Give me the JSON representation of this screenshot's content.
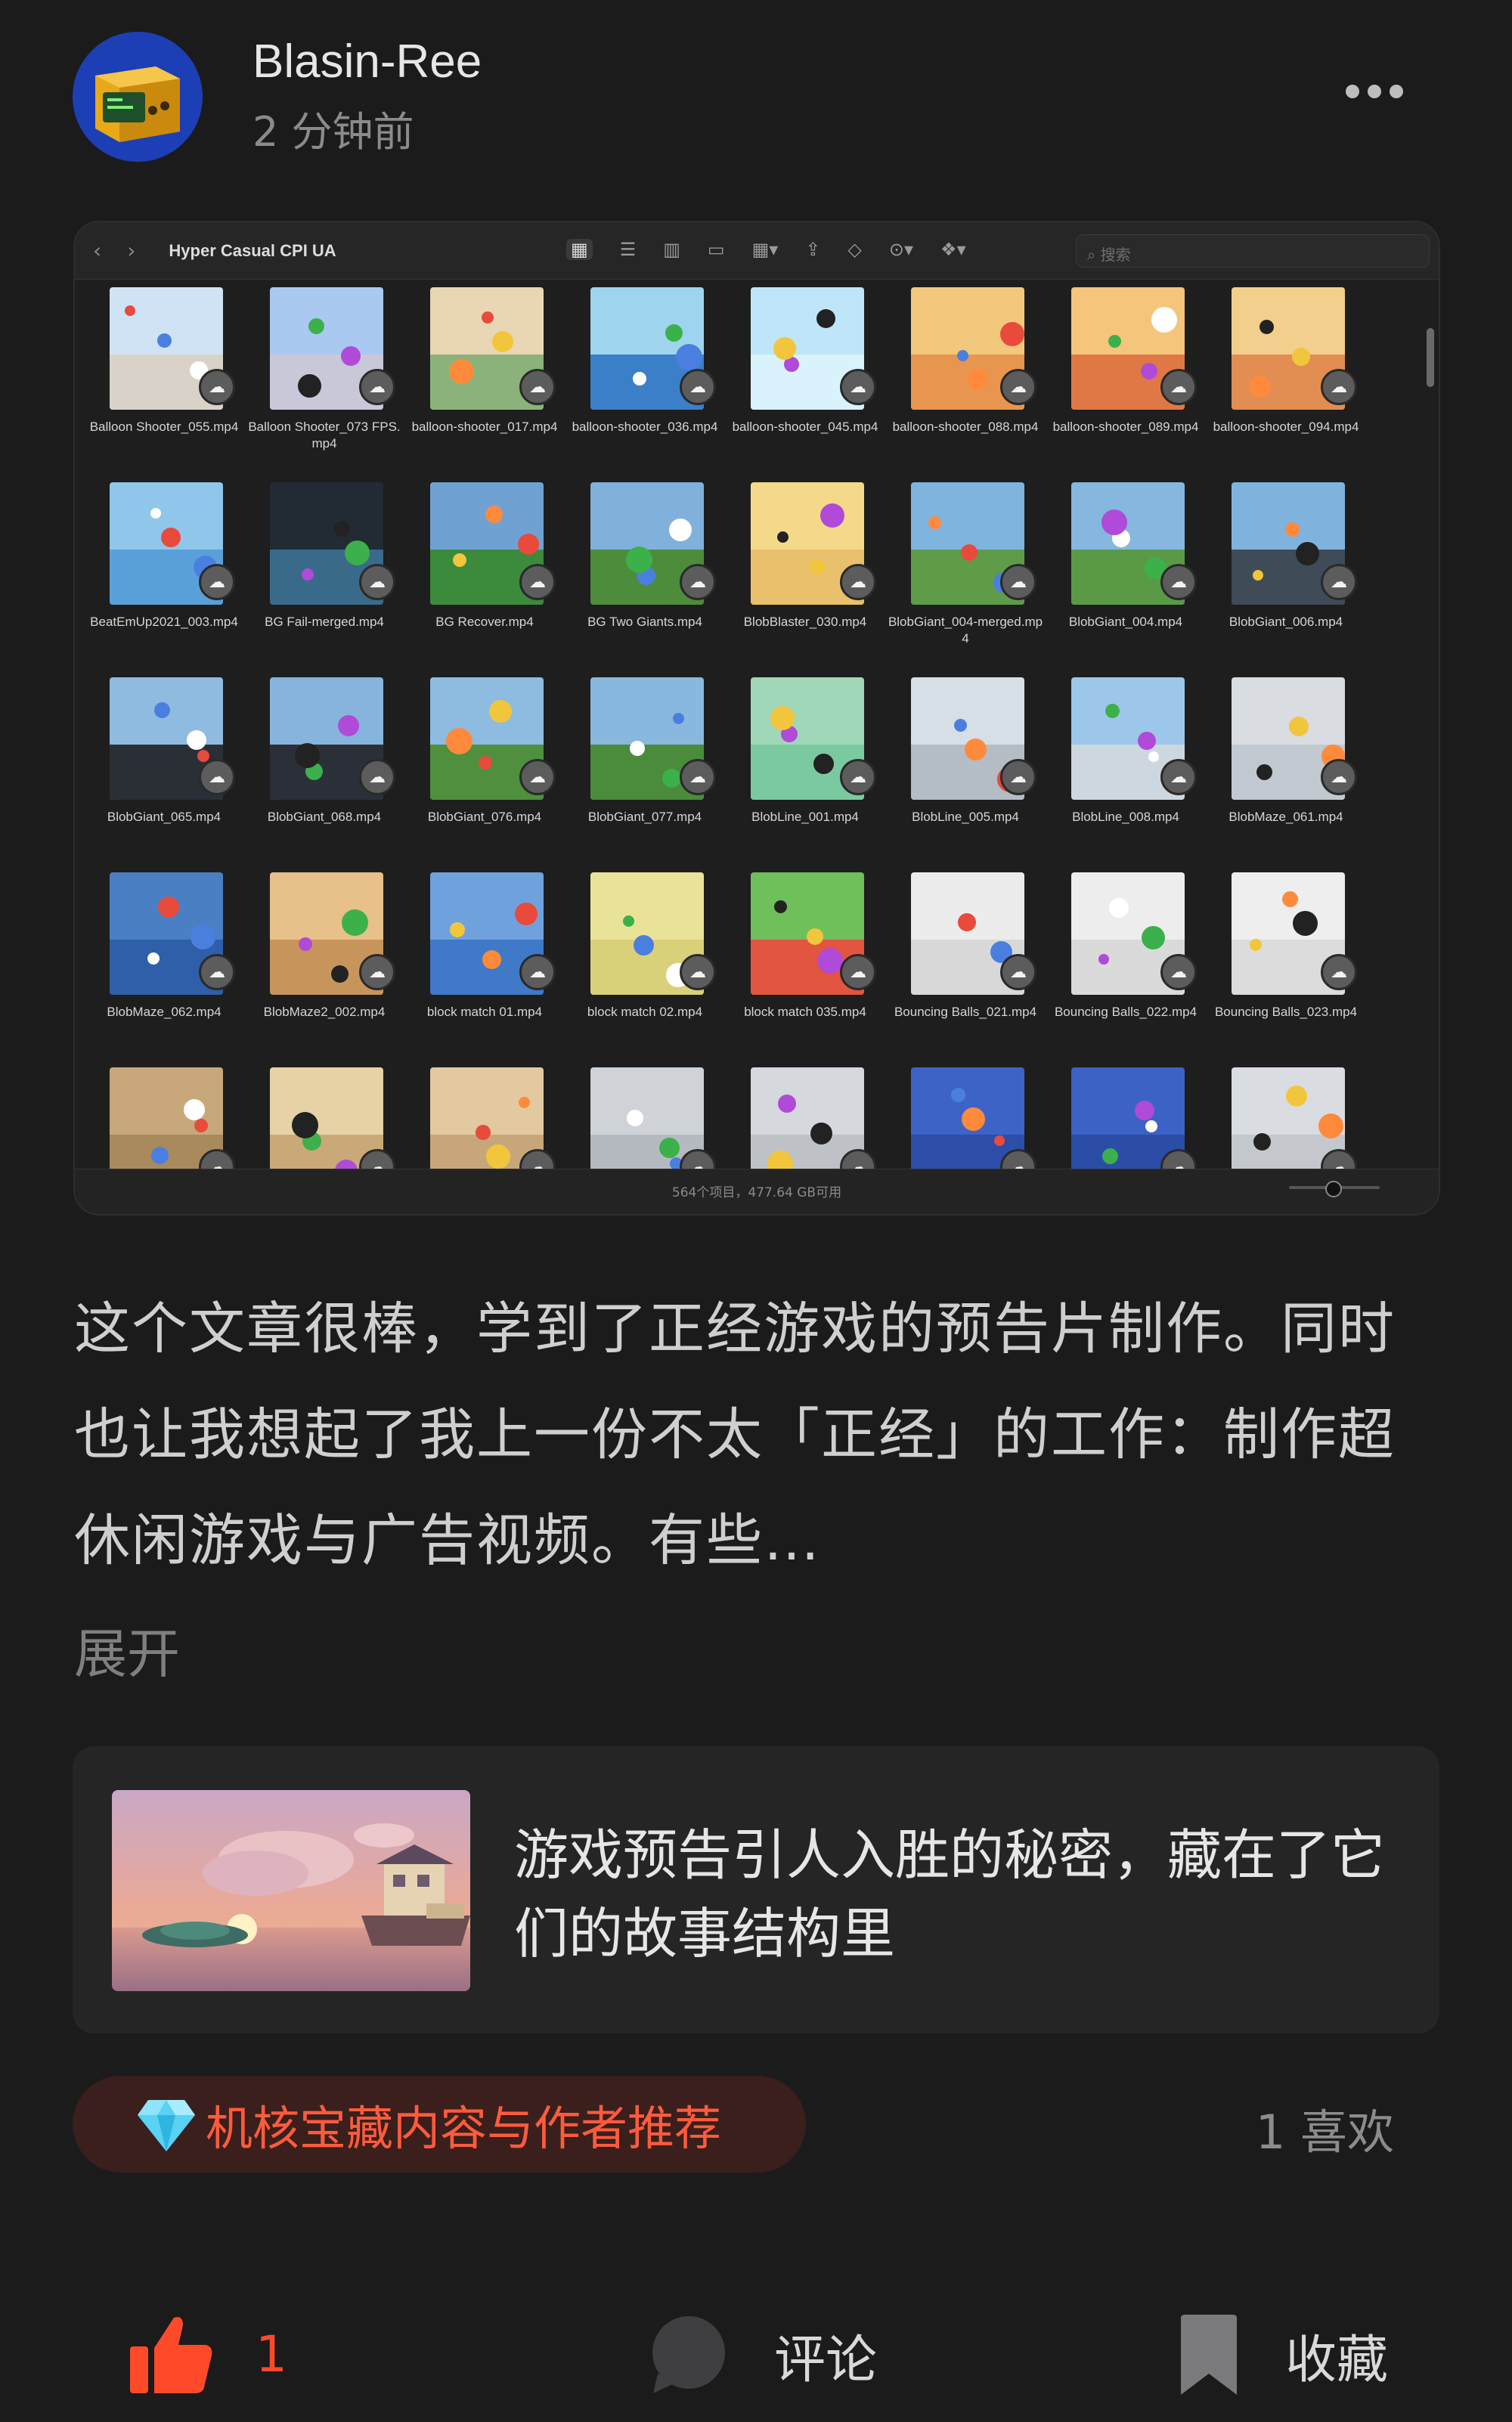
{
  "post": {
    "author": "Blasin-Ree",
    "time": "2 分钟前"
  },
  "finder": {
    "title": "Hyper Casual CPI UA",
    "nav_back": "‹",
    "nav_forward": "›",
    "search_placeholder": "搜索",
    "status": "564个项目，477.64 GB可用",
    "items": [
      "Balloon Shooter_055.mp4",
      "Balloon Shooter_073 FPS.mp4",
      "balloon-shooter_017.mp4",
      "balloon-shooter_036.mp4",
      "balloon-shooter_045.mp4",
      "balloon-shooter_088.mp4",
      "balloon-shooter_089.mp4",
      "balloon-shooter_094.mp4",
      "BeatEmUp2021_003.mp4",
      "BG Fail-merged.mp4",
      "BG Recover.mp4",
      "BG Two Giants.mp4",
      "BlobBlaster_030.mp4",
      "BlobGiant_004-merged.mp4",
      "BlobGiant_004.mp4",
      "BlobGiant_006.mp4",
      "BlobGiant_065.mp4",
      "BlobGiant_068.mp4",
      "BlobGiant_076.mp4",
      "BlobGiant_077.mp4",
      "BlobLine_001.mp4",
      "BlobLine_005.mp4",
      "BlobLine_008.mp4",
      "BlobMaze_061.mp4",
      "BlobMaze_062.mp4",
      "BlobMaze2_002.mp4",
      "block match 01.mp4",
      "block match 02.mp4",
      "block match 035.mp4",
      "Bouncing Balls_021.mp4",
      "Bouncing Balls_022.mp4",
      "Bouncing Balls_023.mp4",
      "",
      "",
      "",
      "",
      "",
      "",
      "",
      ""
    ]
  },
  "body": {
    "text": "这个文章很棒，学到了正经游戏的预告片制作。同时也让我想起了我上一份不太「正经」的工作：制作超休闲游戏与广告视频。有些…",
    "expand": "展开"
  },
  "card": {
    "title": "游戏预告引人入胜的秘密，藏在了它们的故事结构里"
  },
  "recommend": {
    "label": "机核宝藏内容与作者推荐"
  },
  "likes_label": "1 喜欢",
  "actions": {
    "like_count": "1",
    "comment": "评论",
    "save": "收藏"
  },
  "colors": {
    "background": "#1b1b1c",
    "accent": "#ff4a2a",
    "pill_bg": "#3a1f1c"
  }
}
